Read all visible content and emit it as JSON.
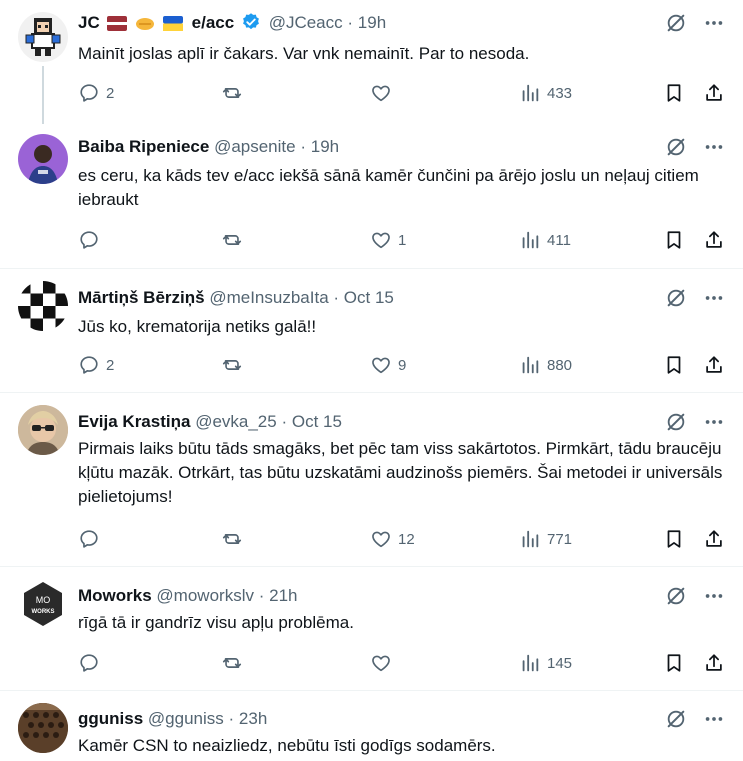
{
  "posts": [
    {
      "name": "JC",
      "badge": "e/acc",
      "handle": "@JCeacc",
      "time": "19h",
      "text": "Mainīt joslas aplī ir čakars. Var vnk nemainīt. Par to nesoda.",
      "replies": "2",
      "reposts": "",
      "likes": "",
      "views": "433"
    },
    {
      "name": "Baiba Ripeniece",
      "handle": "@apsenite",
      "time": "19h",
      "text": "es ceru, ka kāds tev e/acc iekšā sānā kamēr čunčini pa ārējo joslu un neļauj citiem iebraukt",
      "replies": "",
      "reposts": "",
      "likes": "1",
      "views": "411"
    },
    {
      "name": "Mārtiņš Bērziņš",
      "handle": "@meInsuzbaIta",
      "time": "Oct 15",
      "text": "Jūs ko, krematorija netiks galā!!",
      "replies": "2",
      "reposts": "",
      "likes": "9",
      "views": "880"
    },
    {
      "name": "Evija Krastiņa",
      "handle": "@evka_25",
      "time": "Oct 15",
      "text": "Pirmais laiks būtu tāds smagāks, bet pēc tam viss sakārtotos. Pirmkārt, tādu braucēju kļūtu mazāk. Otrkārt, tas būtu uzskatāmi audzinošs piemērs. Šai metodei ir universāls pielietojums!",
      "replies": "",
      "reposts": "",
      "likes": "12",
      "views": "771"
    },
    {
      "name": "Moworks",
      "handle": "@moworkslv",
      "time": "21h",
      "text": "rīgā tā ir gandrīz visu apļu problēma.",
      "replies": "",
      "reposts": "",
      "likes": "",
      "views": "145",
      "avatar_text": "MO\nWORKS"
    },
    {
      "name": "gguniss",
      "handle": "@gguniss",
      "time": "23h",
      "text": "Kamēr CSN to neaizliedz, nebūtu īsti godīgs sodamērs."
    }
  ],
  "separator": "·",
  "colors": {
    "text": "#0f1419",
    "secondary": "#536471",
    "verified": "#1d9bf0",
    "divider": "#eff3f4"
  },
  "icons": [
    "reply-icon",
    "repost-icon",
    "like-icon",
    "views-icon",
    "bookmark-icon",
    "share-icon",
    "grok-icon",
    "more-icon",
    "verified-icon"
  ]
}
